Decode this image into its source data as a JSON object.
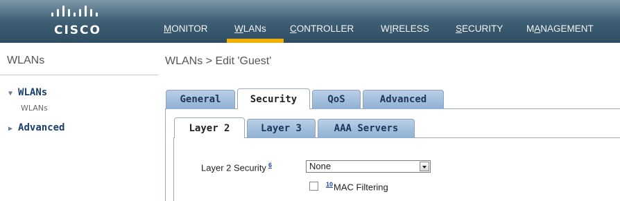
{
  "header": {
    "brand": "CISCO",
    "nav": [
      {
        "prefix": "",
        "underline": "M",
        "rest": "ONITOR"
      },
      {
        "prefix": "",
        "underline": "W",
        "rest": "LANs"
      },
      {
        "prefix": "",
        "underline": "C",
        "rest": "ONTROLLER"
      },
      {
        "prefix": "W",
        "underline": "I",
        "rest": "RELESS"
      },
      {
        "prefix": "",
        "underline": "S",
        "rest": "ECURITY"
      },
      {
        "prefix": "M",
        "underline": "A",
        "rest": "NAGEMENT"
      }
    ],
    "active_nav": "WLANs",
    "accent_color": "#f0b000",
    "bar_color": "#3d5d72"
  },
  "sidebar": {
    "title": "WLANs",
    "items": [
      {
        "label": "WLANs",
        "icon": "triangle-down-icon",
        "sub": "WLANs"
      },
      {
        "label": "Advanced",
        "icon": "triangle-right-icon"
      }
    ]
  },
  "breadcrumb": "WLANs > Edit  'Guest'",
  "tabs": [
    {
      "label": "General"
    },
    {
      "label": "Security"
    },
    {
      "label": "QoS"
    },
    {
      "label": "Advanced"
    }
  ],
  "active_tab": "Security",
  "subtabs": [
    {
      "label": "Layer 2"
    },
    {
      "label": "Layer 3"
    },
    {
      "label": "AAA Servers"
    }
  ],
  "active_subtab": "Layer 2",
  "form": {
    "layer2_label": "Layer 2 Security",
    "layer2_footnote": "6",
    "layer2_value": "None",
    "mac_footnote": "10",
    "mac_label": "MAC Filtering",
    "mac_checked": false
  }
}
